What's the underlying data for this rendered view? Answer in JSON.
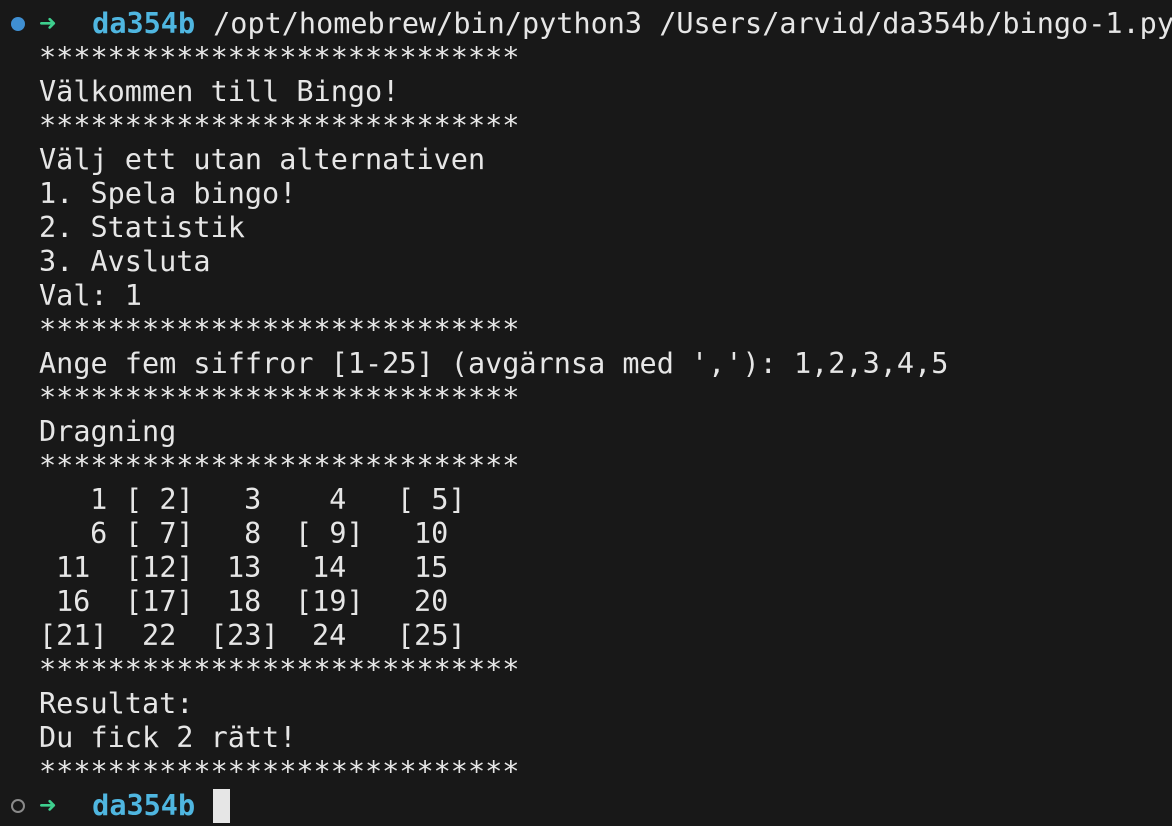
{
  "terminal": {
    "first_prompt": {
      "cwd": "da354b",
      "command": "/opt/homebrew/bin/python3 /Users/arvid/da354b/bingo-1.py"
    },
    "output_before_grid": [
      "****************************",
      "Välkommen till Bingo!",
      "****************************",
      "Välj ett utan alternativen",
      "1. Spela bingo!",
      "2. Statistik",
      "3. Avsluta",
      "Val: 1",
      "****************************",
      "Ange fem siffror [1-25] (avgärnsa med ','): 1,2,3,4,5",
      "****************************",
      "Dragning",
      "****************************"
    ],
    "bingo_grid": [
      [
        " 1",
        "[ 2]",
        " 3",
        " 4",
        "[ 5]"
      ],
      [
        " 6",
        "[ 7]",
        " 8",
        "[ 9]",
        "10"
      ],
      [
        "11",
        "[12]",
        "13",
        "14",
        "15"
      ],
      [
        "16",
        "[17]",
        "18",
        "[19]",
        "20"
      ],
      [
        "[21]",
        "22",
        "[23]",
        "24",
        "[25]"
      ]
    ],
    "output_after_grid": [
      "****************************",
      "Resultat:",
      "Du fick 2 rätt!",
      "****************************"
    ],
    "second_prompt": {
      "cwd": "da354b"
    }
  }
}
